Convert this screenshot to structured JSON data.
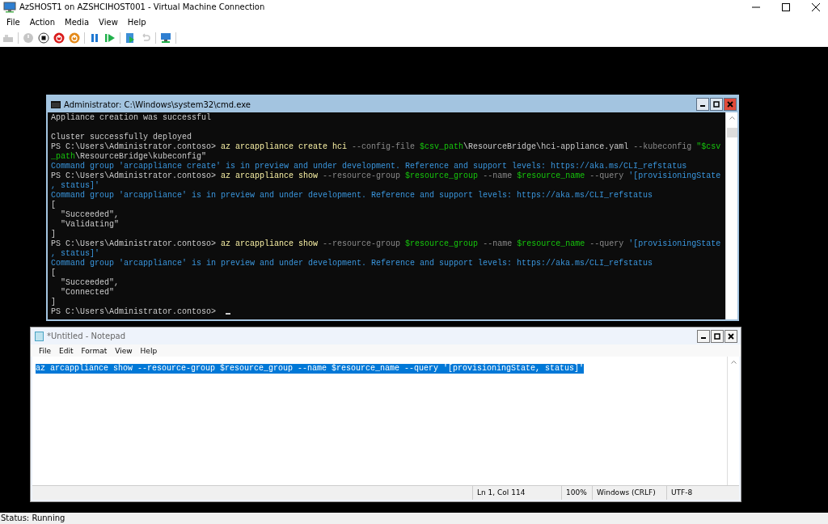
{
  "window": {
    "title": "AzSHOST1 on AZSHCIHOST001 - Virtual Machine Connection"
  },
  "menu": [
    "File",
    "Action",
    "Media",
    "View",
    "Help"
  ],
  "toolbar": [
    {
      "kind": "ctrl-alt-del",
      "disabled": true
    },
    {
      "kind": "start",
      "disabled": true
    },
    {
      "kind": "turn-off",
      "disabled": false
    },
    {
      "kind": "shut-down",
      "disabled": false
    },
    {
      "kind": "save",
      "disabled": false
    },
    {
      "kind": "pause",
      "disabled": false
    },
    {
      "kind": "reset",
      "disabled": false
    },
    {
      "kind": "checkpoint",
      "disabled": false
    },
    {
      "kind": "revert",
      "disabled": true
    },
    {
      "kind": "enhanced-session",
      "disabled": false
    }
  ],
  "console": {
    "title": "Administrator: C:\\Windows\\system32\\cmd.exe",
    "cursor": true,
    "lines": [
      {
        "kind": "text",
        "segments": [
          {
            "kind": "output",
            "text": "Appliance creation was successful"
          }
        ]
      },
      {
        "kind": "blank"
      },
      {
        "kind": "text",
        "segments": [
          {
            "kind": "output",
            "text": "Cluster successfully deployed"
          }
        ]
      },
      {
        "kind": "text",
        "segments": [
          {
            "kind": "output",
            "text": "PS C:\\Users\\Administrator.contoso> "
          },
          {
            "kind": "command",
            "text": "az arcappliance create hci"
          },
          {
            "kind": "parameter",
            "text": " --config-file "
          },
          {
            "kind": "variable",
            "text": "$csv_path"
          },
          {
            "kind": "output",
            "text": "\\ResourceBridge\\hci-appliance.yaml"
          },
          {
            "kind": "parameter",
            "text": " --kubeconfig "
          },
          {
            "kind": "variable",
            "text": "\"$csv"
          }
        ]
      },
      {
        "kind": "text",
        "segments": [
          {
            "kind": "variable",
            "text": "_path"
          },
          {
            "kind": "output",
            "text": "\\ResourceBridge\\kubeconfig\""
          }
        ]
      },
      {
        "kind": "text",
        "segments": [
          {
            "kind": "warning",
            "text": "Command group 'arcappliance create' is in preview and under development. Reference and support levels: https://aka.ms/CLI_refstatus"
          }
        ]
      },
      {
        "kind": "text",
        "segments": [
          {
            "kind": "output",
            "text": "PS C:\\Users\\Administrator.contoso> "
          },
          {
            "kind": "command",
            "text": "az arcappliance show"
          },
          {
            "kind": "parameter",
            "text": " --resource-group "
          },
          {
            "kind": "variable",
            "text": "$resource_group"
          },
          {
            "kind": "parameter",
            "text": " --name "
          },
          {
            "kind": "variable",
            "text": "$resource_name"
          },
          {
            "kind": "parameter",
            "text": " --query "
          },
          {
            "kind": "string",
            "text": "'[provisioningState"
          }
        ]
      },
      {
        "kind": "text",
        "segments": [
          {
            "kind": "string",
            "text": ", status]'"
          }
        ]
      },
      {
        "kind": "text",
        "segments": [
          {
            "kind": "warning",
            "text": "Command group 'arcappliance' is in preview and under development. Reference and support levels: https://aka.ms/CLI_refstatus"
          }
        ]
      },
      {
        "kind": "text",
        "segments": [
          {
            "kind": "output",
            "text": "["
          }
        ]
      },
      {
        "kind": "text",
        "segments": [
          {
            "kind": "output",
            "text": "  \"Succeeded\","
          }
        ]
      },
      {
        "kind": "text",
        "segments": [
          {
            "kind": "output",
            "text": "  \"Validating\""
          }
        ]
      },
      {
        "kind": "text",
        "segments": [
          {
            "kind": "output",
            "text": "]"
          }
        ]
      },
      {
        "kind": "text",
        "segments": [
          {
            "kind": "output",
            "text": "PS C:\\Users\\Administrator.contoso> "
          },
          {
            "kind": "command",
            "text": "az arcappliance show"
          },
          {
            "kind": "parameter",
            "text": " --resource-group "
          },
          {
            "kind": "variable",
            "text": "$resource_group"
          },
          {
            "kind": "parameter",
            "text": " --name "
          },
          {
            "kind": "variable",
            "text": "$resource_name"
          },
          {
            "kind": "parameter",
            "text": " --query "
          },
          {
            "kind": "string",
            "text": "'[provisioningState"
          }
        ]
      },
      {
        "kind": "text",
        "segments": [
          {
            "kind": "string",
            "text": ", status]'"
          }
        ]
      },
      {
        "kind": "text",
        "segments": [
          {
            "kind": "warning",
            "text": "Command group 'arcappliance' is in preview and under development. Reference and support levels: https://aka.ms/CLI_refstatus"
          }
        ]
      },
      {
        "kind": "text",
        "segments": [
          {
            "kind": "output",
            "text": "["
          }
        ]
      },
      {
        "kind": "text",
        "segments": [
          {
            "kind": "output",
            "text": "  \"Succeeded\","
          }
        ]
      },
      {
        "kind": "text",
        "segments": [
          {
            "kind": "output",
            "text": "  \"Connected\""
          }
        ]
      },
      {
        "kind": "text",
        "segments": [
          {
            "kind": "output",
            "text": "]"
          }
        ]
      },
      {
        "kind": "text",
        "segments": [
          {
            "kind": "output",
            "text": "PS C:\\Users\\Administrator.contoso> "
          }
        ]
      }
    ]
  },
  "notepad": {
    "title": "*Untitled - Notepad",
    "menu": [
      "File",
      "Edit",
      "Format",
      "View",
      "Help"
    ],
    "text": "az arcappliance show --resource-group $resource_group --name $resource_name --query '[provisioningState, status]'",
    "selected": true,
    "status": [
      "Ln 1, Col 114",
      "100%",
      "Windows (CRLF)",
      "UTF-8"
    ]
  },
  "status_bar": {
    "text": "Status: Running"
  }
}
